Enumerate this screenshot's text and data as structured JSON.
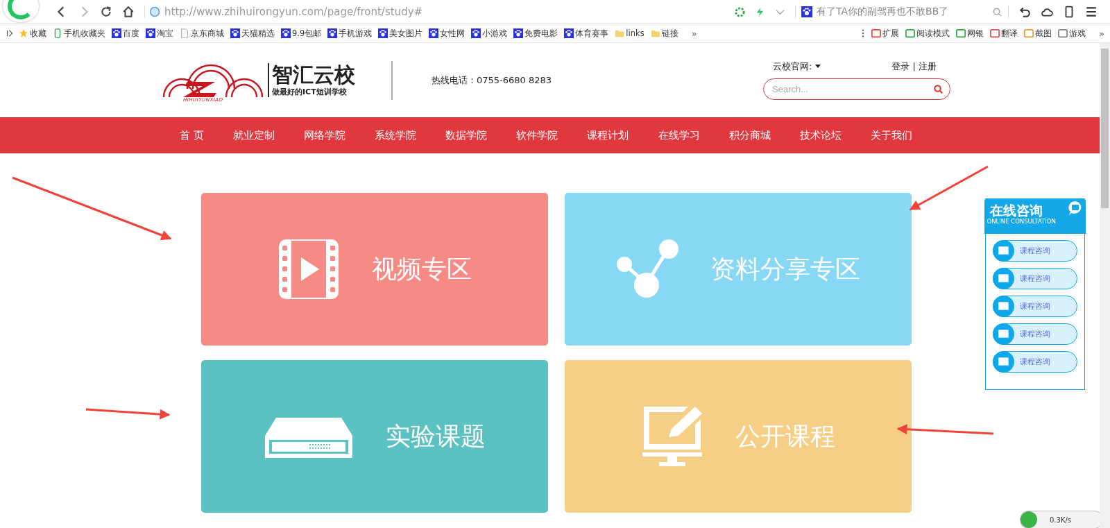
{
  "browser": {
    "address": "http://www.zhihuirongyun.com/page/front/study#",
    "search_text": "有了TA你的副驾再也不敢BB了",
    "bookmarks": [
      {
        "label": "收藏",
        "kind": "star"
      },
      {
        "label": "手机收藏夹",
        "kind": "phone"
      },
      {
        "label": "百度",
        "kind": "paw"
      },
      {
        "label": "淘宝",
        "kind": "paw"
      },
      {
        "label": "京东商城",
        "kind": "page"
      },
      {
        "label": "天猫精选",
        "kind": "paw"
      },
      {
        "label": "9.9包邮",
        "kind": "paw"
      },
      {
        "label": "手机游戏",
        "kind": "paw"
      },
      {
        "label": "美女图片",
        "kind": "paw"
      },
      {
        "label": "女性网",
        "kind": "paw"
      },
      {
        "label": "小游戏",
        "kind": "paw"
      },
      {
        "label": "免费电影",
        "kind": "paw"
      },
      {
        "label": "体育赛事",
        "kind": "paw"
      },
      {
        "label": "links",
        "kind": "folder"
      },
      {
        "label": "链接",
        "kind": "folder"
      }
    ],
    "tools": [
      {
        "label": "扩展",
        "color": "#e8493b"
      },
      {
        "label": "阅读模式",
        "color": "#2eaa4a"
      },
      {
        "label": "网银",
        "color": "#2eaa4a"
      },
      {
        "label": "翻译",
        "color": "#e05050"
      },
      {
        "label": "截图",
        "color": "#e0a030"
      },
      {
        "label": "游戏",
        "color": "#888888"
      }
    ],
    "more": "»",
    "tools_more": "»",
    "speed": "0.3K/s"
  },
  "header": {
    "logo_name": "智汇云校",
    "logo_slogan": "做最好的ICT短训学校",
    "logo_pinyin": "HIHUIYUNXIAO",
    "hotline": "热线电话：0755-6680 8283",
    "site_menu": "云校官网:",
    "login": "登录 | 注册",
    "search": {
      "placeholder": "Search..."
    }
  },
  "nav": [
    "首 页",
    "就业定制",
    "网络学院",
    "系统学院",
    "数据学院",
    "软件学院",
    "课程计划",
    "在线学习",
    "积分商城",
    "技术论坛",
    "关于我们"
  ],
  "tiles": [
    {
      "title": "视频专区",
      "kind": "video",
      "color": "#f68b85"
    },
    {
      "title": "资料分享专区",
      "kind": "share",
      "color": "#87d8f5"
    },
    {
      "title": "实验课题",
      "kind": "lab",
      "color": "#5bc2c1"
    },
    {
      "title": "公开课程",
      "kind": "course",
      "color": "#f6cf86"
    }
  ],
  "consult": {
    "title": "在线咨询",
    "subtitle": "ONLINE CONSULTATION",
    "items": [
      "课程咨询",
      "课程咨询",
      "课程咨询",
      "课程咨询",
      "课程咨询"
    ]
  }
}
